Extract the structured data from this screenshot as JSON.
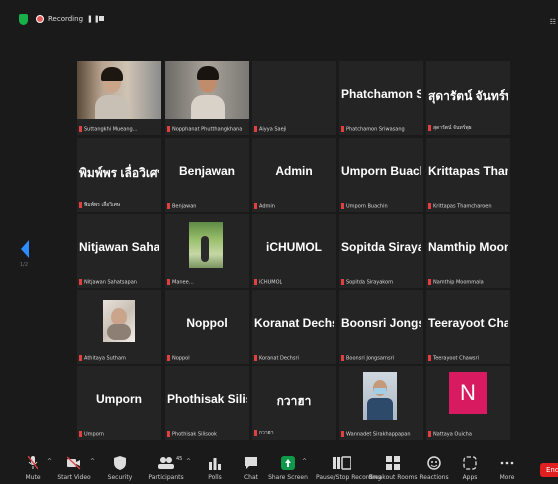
{
  "topbar": {
    "recording_label": "Recording"
  },
  "pagination": {
    "page": "1/2"
  },
  "tiles": [
    {
      "name": "",
      "label": "Suttangkhi Mueang…"
    },
    {
      "name": "",
      "label": "Nopphanat Phutthangkhana"
    },
    {
      "name": "",
      "label": "Aiyya Saeji"
    },
    {
      "name": "Phatchamon Sri...",
      "label": "Phatchamon Sriwasang"
    },
    {
      "name": "สุดารัตน์ จันทร์พุธ",
      "label": "สุดารัตน์ จันทร์พุธ"
    },
    {
      "name": "พิมพ์พร เลื่อวิเศษ...",
      "label": "พิมพ์พร เลื่อวิเศษ"
    },
    {
      "name": "Benjawan",
      "label": "Benjawan"
    },
    {
      "name": "Admin",
      "label": "Admin"
    },
    {
      "name": "Umporn Buachin",
      "label": "Umporn Buachin"
    },
    {
      "name": "Krittapas Tham...",
      "label": "Krittapas Thamcharoen"
    },
    {
      "name": "Nitjawan Sahat...",
      "label": "Nitjawan Sahatsapan"
    },
    {
      "name": "",
      "label": "Manee…"
    },
    {
      "name": "iCHUMOL",
      "label": "iCHUMOL"
    },
    {
      "name": "Sopitda Sirayak...",
      "label": "Sopitda Sirayakorn"
    },
    {
      "name": "Namthip Moom...",
      "label": "Namthip Moommala"
    },
    {
      "name": "",
      "label": "Athitaya Sutham"
    },
    {
      "name": "Noppol",
      "label": "Noppol"
    },
    {
      "name": "Koranat Dechsri",
      "label": "Koranat Dechsri"
    },
    {
      "name": "Boonsri Jongsar...",
      "label": "Boonsri Jongsarnsri"
    },
    {
      "name": "Teerayoot Chaw...",
      "label": "Teerayoot Chawsri"
    },
    {
      "name": "Umporn",
      "label": "Umporn"
    },
    {
      "name": "Phothisak Siliso...",
      "label": "Phothisak Silisook"
    },
    {
      "name": "กวาฮา",
      "label": "กวาฮา"
    },
    {
      "name": "",
      "label": "Wannadet Sirakhappapan"
    },
    {
      "name": "",
      "label": "Nattaya Ouicha"
    }
  ],
  "avatar_letter": "N",
  "toolbar": {
    "mute": "Mute",
    "start_video": "Start Video",
    "security": "Security",
    "participants": "Participants",
    "participants_count": "45",
    "polls": "Polls",
    "chat": "Chat",
    "share_screen": "Share Screen",
    "record": "Pause/Stop Recording",
    "breakout": "Breakout Rooms",
    "reactions": "Reactions",
    "apps": "Apps",
    "more": "More",
    "end": "End"
  },
  "colors": {
    "accent": "#2d8cff",
    "share": "#0e9a4a",
    "end": "#e02020",
    "avatar": "#d81b60",
    "mic_muted": "#e04040"
  }
}
